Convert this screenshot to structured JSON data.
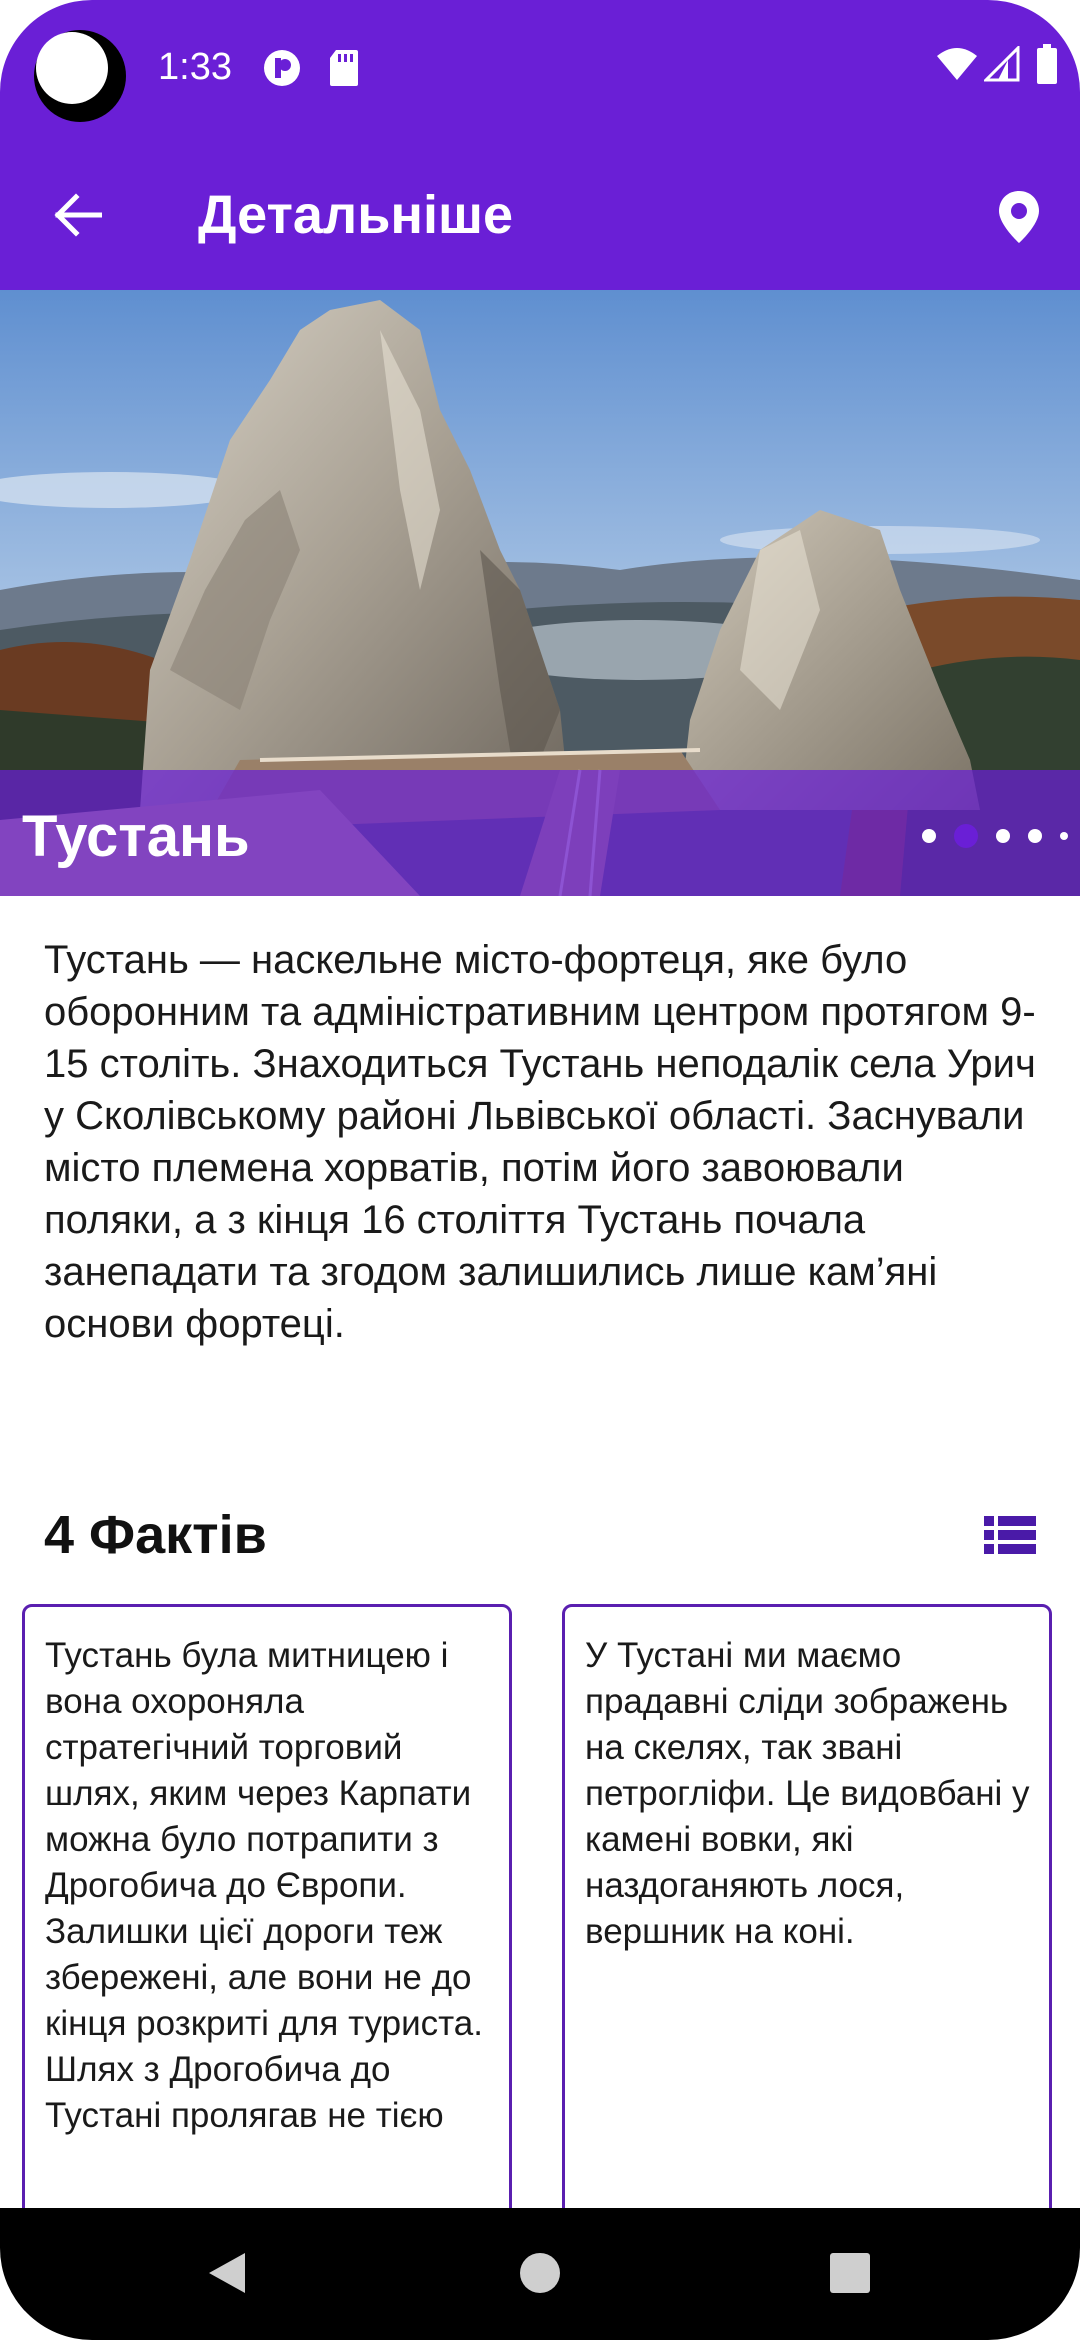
{
  "status": {
    "time": "1:33"
  },
  "appbar": {
    "title": "Детальніше"
  },
  "hero": {
    "name": "Тустань",
    "dots_total": 5,
    "dots_active_index": 1
  },
  "description": "Тустань — наскельне місто-фортеця, яке було оборонним та адміністративним центром протягом 9-15 століть. Знаходиться Тустань неподалік села Урич у Сколівському районі Львівської області. Заснували місто племена хорватів, потім його завоювали поляки, а з кінця 16 століття Тустань почала занепадати та згодом залишились лише кам’яні основи фортеці.",
  "facts": {
    "header": "4 Фактів",
    "cards": [
      {
        "text": "Тустань була митницею і вона охороняла стратегічний торговий шлях, яким через Карпати можна було потрапити з Дрогобича до Європи. Залишки цієї дороги теж збережені, але вони не до кінця розкриті для туриста. Шлях з Дрогобича до Тустані пролягав не тією"
      },
      {
        "text": "У Тустані ми маємо прадавні сліди зображень на скелях, так звані петрогліфи. Це видовбані у камені вовки, які наздоганяють лося, вершник на коні."
      }
    ]
  },
  "colors": {
    "primary": "#6a1fd6",
    "card_border": "#5a1fb0",
    "icon_dark": "#4a1aa8"
  },
  "icons": {
    "back": "arrow-left-icon",
    "location": "location-pin-icon",
    "list": "list-view-icon",
    "nav_back": "triangle-back-icon",
    "nav_home": "circle-home-icon",
    "nav_recents": "square-recents-icon"
  }
}
